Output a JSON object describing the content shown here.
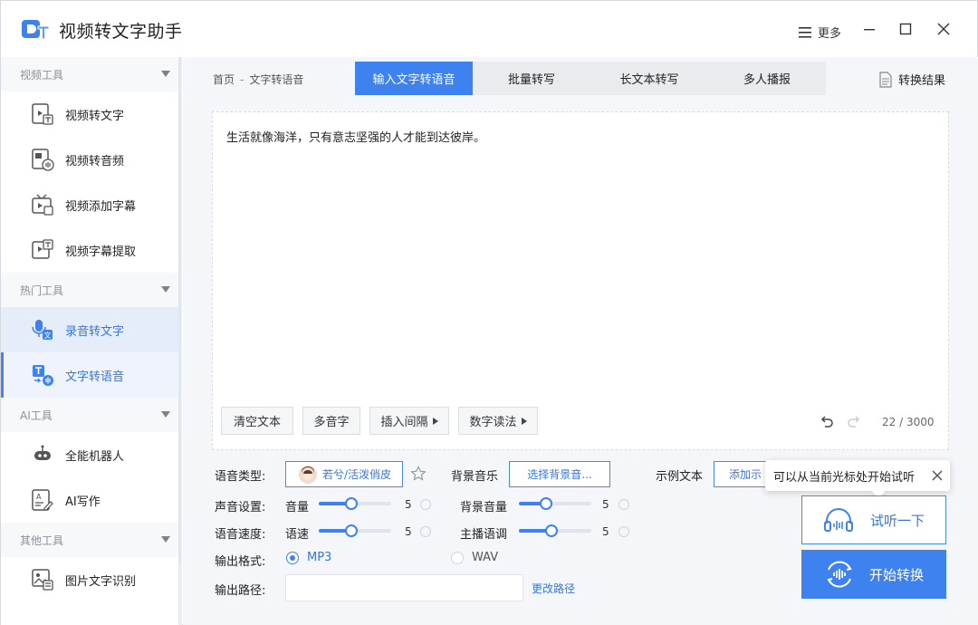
{
  "window": {
    "title": "视频转文字助手",
    "more_label": "更多"
  },
  "sidebar": {
    "groups": [
      {
        "title": "视频工具",
        "items": [
          {
            "label": "视频转文字",
            "icon": "video-to-text-icon"
          },
          {
            "label": "视频转音频",
            "icon": "video-to-audio-icon"
          },
          {
            "label": "视频添加字幕",
            "icon": "add-subtitle-icon"
          },
          {
            "label": "视频字幕提取",
            "icon": "extract-subtitle-icon"
          }
        ]
      },
      {
        "title": "热门工具",
        "items": [
          {
            "label": "录音转文字",
            "icon": "mic-to-text-icon"
          },
          {
            "label": "文字转语音",
            "icon": "text-to-speech-icon"
          }
        ]
      },
      {
        "title": "AI工具",
        "items": [
          {
            "label": "全能机器人",
            "icon": "robot-icon"
          },
          {
            "label": "AI写作",
            "icon": "ai-writing-icon"
          }
        ]
      },
      {
        "title": "其他工具",
        "items": [
          {
            "label": "图片文字识别",
            "icon": "ocr-icon"
          }
        ]
      }
    ]
  },
  "breadcrumb": {
    "home": "首页",
    "separator": "-",
    "current": "文字转语音"
  },
  "tabs": [
    {
      "label": "输入文字转语音",
      "active": true
    },
    {
      "label": "批量转写",
      "active": false
    },
    {
      "label": "长文本转写",
      "active": false
    },
    {
      "label": "多人播报",
      "active": false
    }
  ],
  "result_label": "转换结果",
  "editor": {
    "text": "生活就像海洋，只有意志坚强的人才能到达彼岸。",
    "tools": {
      "clear": "清空文本",
      "polyphone": "多音字",
      "insert_pause": "插入间隔",
      "number_reading": "数字读法"
    },
    "counter": "22 / 3000"
  },
  "settings": {
    "voice_type_label": "语音类型:",
    "voice_value": "若兮/活泼俏皮",
    "bg_music_label": "背景音乐",
    "bg_music_button": "选择背景音...",
    "sample_text_label": "示例文本",
    "sample_text_button": "添加示",
    "sound_label": "声音设置:",
    "volume_label": "音量",
    "volume_value": "5",
    "bg_volume_label": "背景音量",
    "bg_volume_value": "5",
    "speed_label": "语音速度:",
    "speed_sub_label": "语速",
    "speed_value": "5",
    "pitch_label": "主播语调",
    "pitch_value": "5",
    "format_label": "输出格式:",
    "format_mp3": "MP3",
    "format_wav": "WAV",
    "format_selected": "MP3",
    "path_label": "输出路径:",
    "path_value": "",
    "change_path": "更改路径"
  },
  "tooltip": {
    "text": "可以从当前光标处开始试听"
  },
  "buttons": {
    "listen": "试听一下",
    "convert": "开始转换"
  },
  "colors": {
    "accent": "#3d82ef",
    "active_item_bg": "#e5edfb"
  }
}
